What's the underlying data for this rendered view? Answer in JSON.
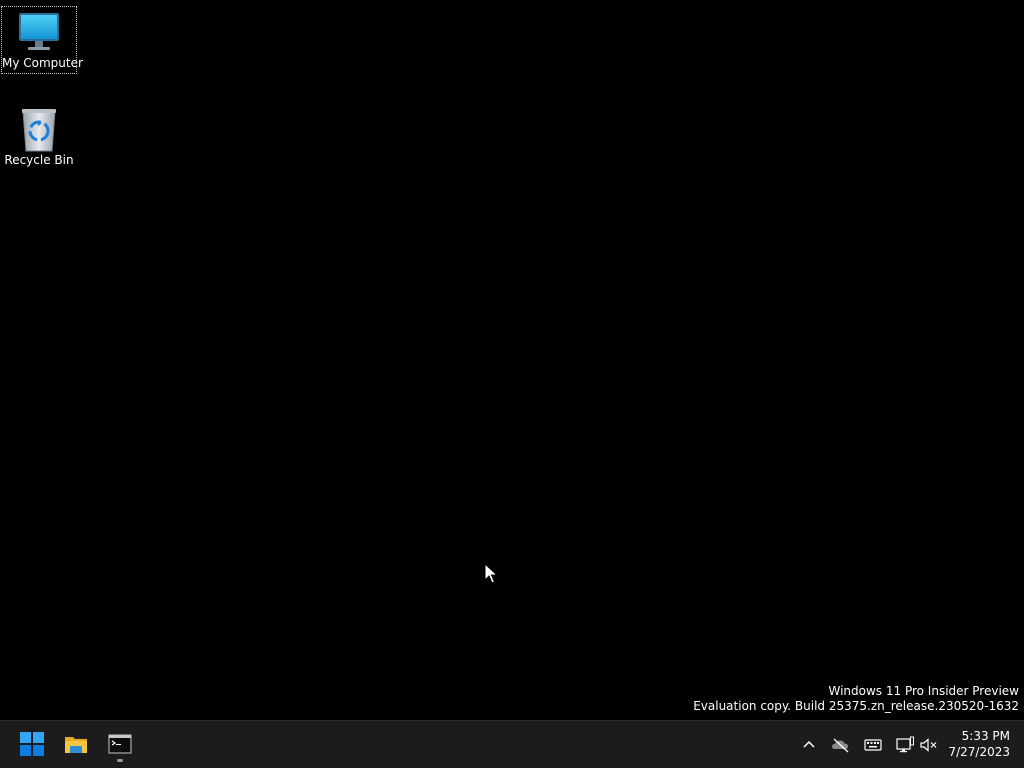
{
  "desktop": {
    "icons": [
      {
        "label": "My Computer",
        "icon": "monitor-icon",
        "selected": true
      },
      {
        "label": "Recycle Bin",
        "icon": "recycle-bin-icon",
        "selected": false
      }
    ],
    "watermark": {
      "line1": "Windows 11 Pro Insider Preview",
      "line2": "Evaluation copy. Build 25375.zn_release.230520-1632"
    }
  },
  "taskbar": {
    "apps": [
      {
        "name": "Start",
        "icon": "windows-start-icon"
      },
      {
        "name": "File Explorer",
        "icon": "folder-icon"
      },
      {
        "name": "Command Prompt",
        "icon": "terminal-icon",
        "running": true
      }
    ],
    "tray": {
      "icons": [
        "chevron-up-icon",
        "onedrive-offline-icon",
        "keyboard-icon",
        "network-icon",
        "volume-muted-icon"
      ]
    },
    "clock": {
      "time": "5:33 PM",
      "date": "7/27/2023"
    }
  },
  "colors": {
    "desktop_background": "#000000",
    "taskbar_background": "#1c1c1c",
    "start_blue": "#0a84ff",
    "folder_yellow": "#f6c342"
  }
}
